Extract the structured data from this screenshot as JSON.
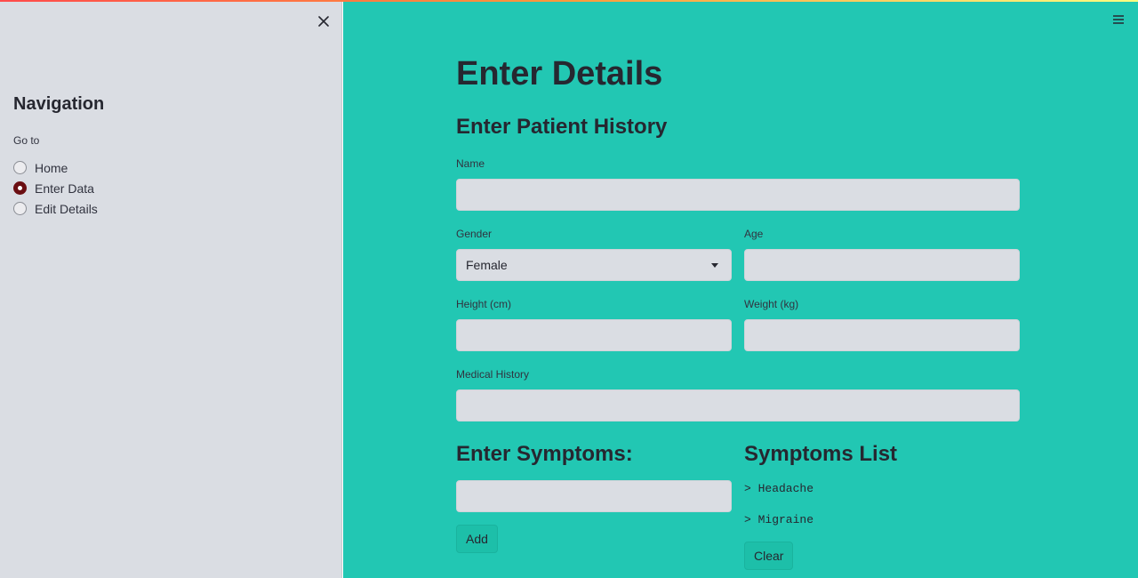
{
  "sidebar": {
    "title": "Navigation",
    "goto_label": "Go to",
    "options": [
      {
        "label": "Home",
        "selected": false
      },
      {
        "label": "Enter Data",
        "selected": true
      },
      {
        "label": "Edit Details",
        "selected": false
      }
    ],
    "close_icon": "close-icon"
  },
  "header": {
    "menu_icon": "hamburger-menu-icon",
    "accent_gradient": [
      "#ff4b4b",
      "#ff9a3c",
      "#fffd80"
    ]
  },
  "main": {
    "title": "Enter Details",
    "history_heading": "Enter Patient History",
    "fields": {
      "name": {
        "label": "Name",
        "value": ""
      },
      "gender": {
        "label": "Gender",
        "value": "Female"
      },
      "age": {
        "label": "Age",
        "value": ""
      },
      "height": {
        "label": "Height (cm)",
        "value": ""
      },
      "weight": {
        "label": "Weight (kg)",
        "value": ""
      },
      "medical_history": {
        "label": "Medical History",
        "value": ""
      }
    },
    "symptoms_heading": "Enter Symptoms:",
    "symptom_input": {
      "value": ""
    },
    "add_label": "Add",
    "symptoms_list_heading": "Symptoms List",
    "symptoms": [
      "> Headache",
      "> Migraine"
    ],
    "clear_label": "Clear"
  },
  "colors": {
    "main_bg": "#22c7b3",
    "sidebar_bg": "#dadde3",
    "radio_selected": "#6b0e12"
  }
}
